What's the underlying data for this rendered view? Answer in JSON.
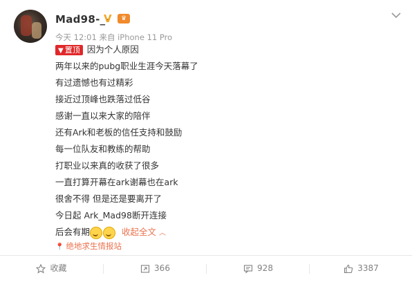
{
  "user": {
    "name": "Mad98-_-",
    "verified_mark": "V",
    "vip_mark": "♛",
    "post_meta": "今天 12:01 来自 iPhone 11 Pro"
  },
  "post": {
    "pin_label": "置顶",
    "lines": [
      "因为个人原因",
      "两年以来的pubg职业生涯今天落幕了",
      "有过遗憾也有过精彩",
      "接近过顶峰也跌落过低谷",
      "感谢一直以来大家的陪伴",
      "还有Ark和老板的信任支持和鼓励",
      "每一位队友和教练的帮助",
      "打职业以来真的收获了很多",
      "一直打算开幕在ark谢幕也在ark",
      "很舍不得 但是还是要离开了",
      "今日起 Ark_Mad98断开连接",
      "后会有期"
    ],
    "collapse_label": "收起全文",
    "location": "绝地求生情报站"
  },
  "actions": {
    "favorite_label": "收藏",
    "repost_count": "366",
    "comment_count": "928",
    "like_count": "3387"
  },
  "colors": {
    "accent": "#eb7350",
    "pin": "#e0282a",
    "meta": "#999999"
  }
}
